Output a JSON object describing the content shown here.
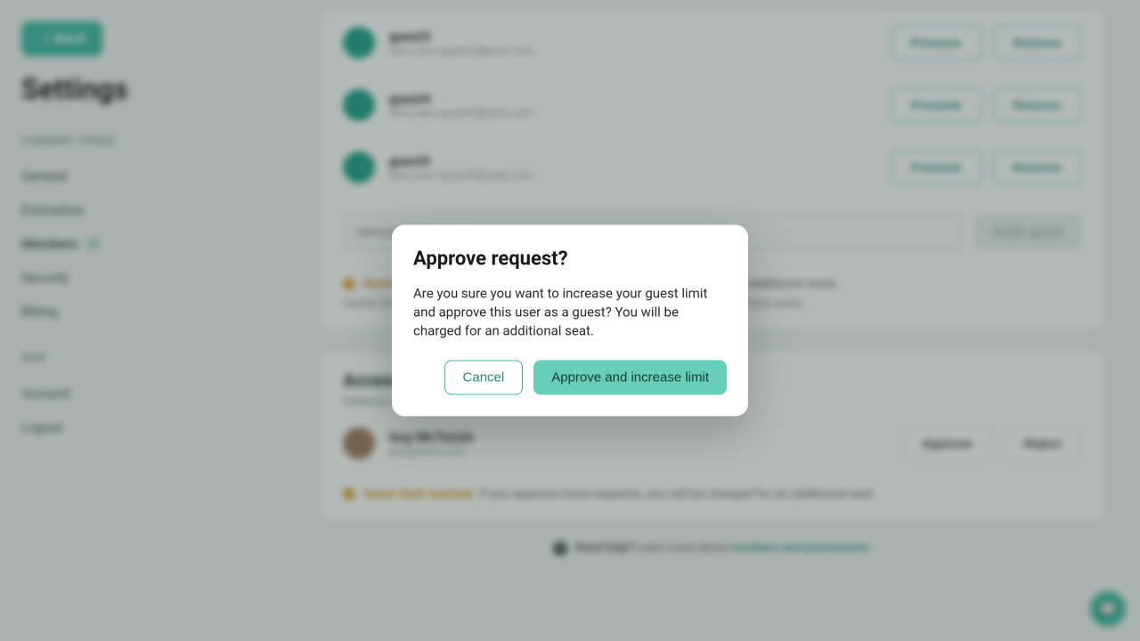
{
  "sidebar": {
    "back_label": "Back",
    "page_title": "Settings",
    "group_current": "CURRENT SPACE",
    "group_don": "DON",
    "items": [
      {
        "label": "General"
      },
      {
        "label": "Estimation"
      },
      {
        "label": "Members",
        "badge": "1",
        "active": true
      },
      {
        "label": "Security"
      },
      {
        "label": "Billing"
      }
    ],
    "items_lower": [
      {
        "label": "Account"
      },
      {
        "label": "Logout"
      }
    ]
  },
  "guests": [
    {
      "name": "guest3",
      "email": "test.user+guest3@estii.com"
    },
    {
      "name": "guest4",
      "email": "test.user+guest4@estii.com"
    },
    {
      "name": "guest5",
      "email": "test.user+guest5@estii.com"
    }
  ],
  "guest_actions": {
    "promote": "Promote",
    "remove": "Remove"
  },
  "invite": {
    "placeholder": "name@company.com",
    "button": "Invite guest"
  },
  "warn1": {
    "lead": "Guest limit reached.",
    "tail": "If you invite more guests, you will be charged for additional seats.",
    "sub": "Guest limit is linked to how many paid seats you have (5 guests per additional seat)."
  },
  "access": {
    "title": "Access requests",
    "sub": "External users who have requested access to your space.",
    "request": {
      "name": "Guy McTavish",
      "email": "guy@estii.com"
    },
    "approve": "Approve",
    "reject": "Reject"
  },
  "warn2": {
    "lead": "Guest limit reached.",
    "tail": "If you approve more requests, you will be charged for an additional seat."
  },
  "help": {
    "prefix": "Need help?",
    "mid": "Learn more about",
    "link": "members and permissions"
  },
  "modal": {
    "title": "Approve request?",
    "body": "Are you sure you want to increase your guest limit and approve this user as a guest? You will be charged for an additional seat.",
    "cancel": "Cancel",
    "confirm": "Approve and increase limit"
  }
}
